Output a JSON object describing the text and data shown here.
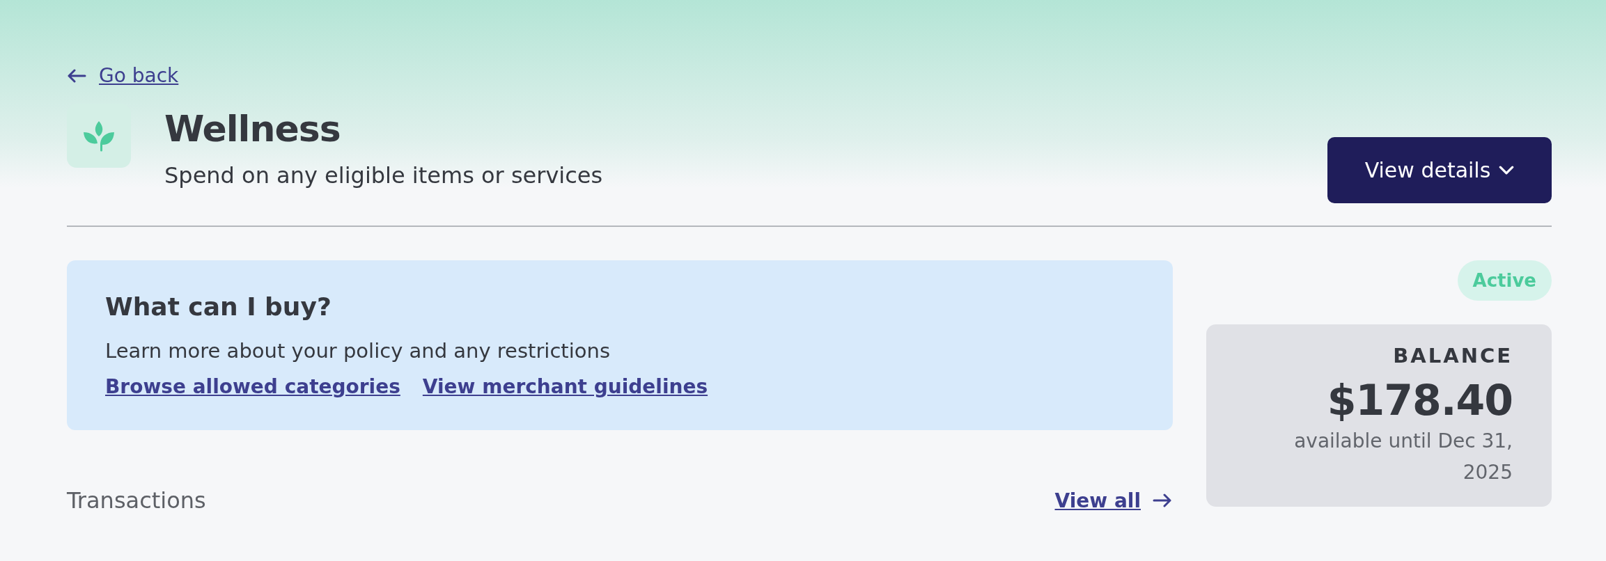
{
  "back_link": {
    "label": "Go back"
  },
  "header": {
    "title": "Wellness",
    "subtitle": "Spend on any eligible items or services",
    "action": "View details"
  },
  "info_card": {
    "title": "What can I buy?",
    "text": "Learn more about your policy and any restrictions",
    "links": [
      "Browse allowed categories",
      "View merchant guidelines"
    ]
  },
  "status": {
    "label": "Active"
  },
  "balance": {
    "label": "BALANCE",
    "amount": "$178.40",
    "note": "available until Dec 31, 2025"
  },
  "transactions": {
    "title": "Transactions",
    "link": "View all"
  }
}
